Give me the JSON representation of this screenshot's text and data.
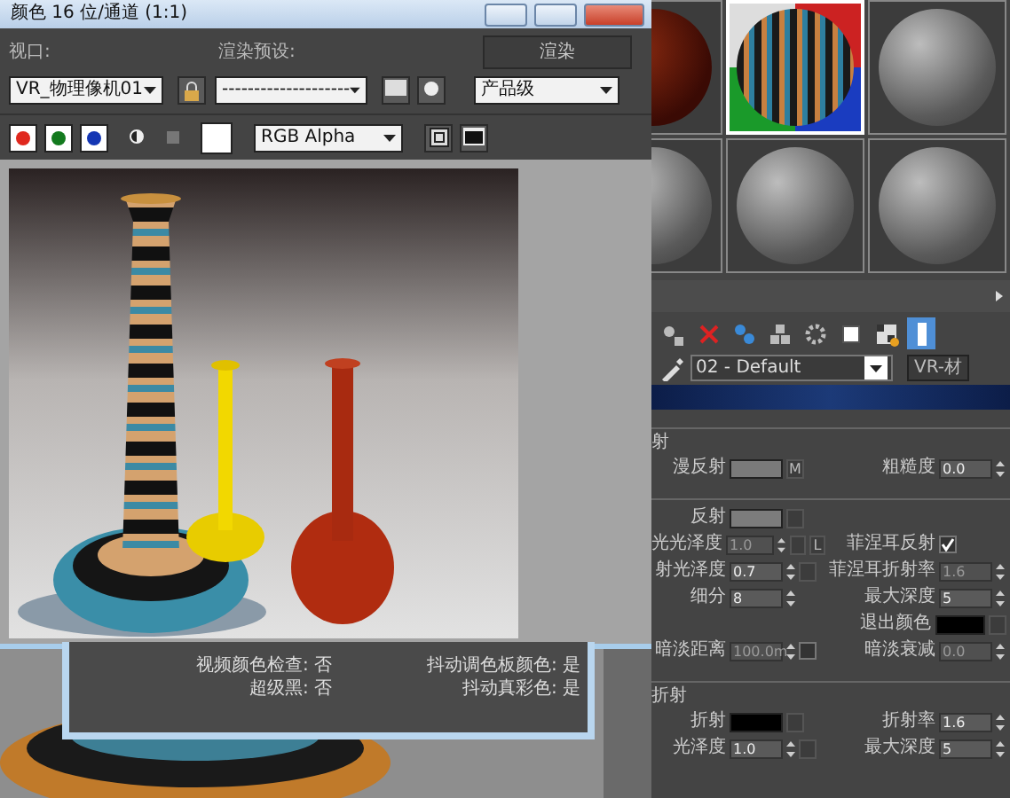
{
  "render_window": {
    "title": "颜色 16 位/通道 (1:1)",
    "viewport_label": "视口:",
    "viewport_value": "VR_物理像机01",
    "preset_label": "渲染预设:",
    "preset_value": "--------------------",
    "render_button": "渲染",
    "quality_value": "产品级",
    "channels": [
      {
        "color": "#e0281e",
        "on": true
      },
      {
        "color": "#137a1e",
        "on": true
      },
      {
        "color": "#1436b4",
        "on": true
      }
    ],
    "display_value": "RGB Alpha"
  },
  "info_panel": {
    "items": [
      {
        "label": "视频颜色检查:",
        "value": "否"
      },
      {
        "label": "抖动调色板颜色:",
        "value": "是"
      },
      {
        "label": "超级黑:",
        "value": "否"
      },
      {
        "label": "抖动真彩色:",
        "value": "是"
      }
    ]
  },
  "material_editor": {
    "slots": [
      {
        "kind": "wood",
        "selected": false
      },
      {
        "kind": "striped",
        "selected": true
      },
      {
        "kind": "plain",
        "selected": false
      },
      {
        "kind": "plain",
        "selected": false
      },
      {
        "kind": "plain",
        "selected": false
      },
      {
        "kind": "plain",
        "selected": false
      }
    ],
    "toolbar": [
      {
        "on": false
      },
      {
        "on": false
      },
      {
        "on": false
      },
      {
        "on": false
      },
      {
        "on": false
      },
      {
        "on": false
      },
      {
        "on": false
      },
      {
        "on": true
      }
    ],
    "material_name": "02 - Default",
    "type_button": "VR-材",
    "sections": [
      {
        "title": "射",
        "rows": [
          {
            "left": {
              "kind": "swatch",
              "label": "漫反射",
              "color": "#7a7a7a",
              "map": "M"
            },
            "right": {
              "kind": "spinner",
              "label": "粗糙度",
              "value": "0.0",
              "disabled": false
            }
          }
        ]
      },
      {
        "rows": [
          {
            "left": {
              "kind": "swatch",
              "label": "反射",
              "color": "#7c7c7c"
            }
          },
          {
            "left": {
              "kind": "spinner",
              "label": "光光泽度",
              "value": "1.0",
              "disabled": true,
              "map_slot": true,
              "lock": "L"
            },
            "right": {
              "kind": "checkbox",
              "label": "菲涅耳反射",
              "checked": true
            }
          },
          {
            "left": {
              "kind": "spinner",
              "label": "射光泽度",
              "value": "0.7",
              "disabled": false,
              "map_slot": true
            },
            "right": {
              "kind": "spinner",
              "label": "菲涅耳折射率",
              "value": "1.6",
              "disabled": true
            }
          },
          {
            "left": {
              "kind": "spinner",
              "label": "细分",
              "value": "8",
              "disabled": false
            },
            "right": {
              "kind": "spinner",
              "label": "最大深度",
              "value": "5",
              "disabled": false
            }
          },
          {
            "right": {
              "kind": "swatch",
              "label": "退出颜色",
              "color": "#000000"
            }
          },
          {
            "left": {
              "kind": "spinner",
              "label": "暗淡距离",
              "value": "100.0m",
              "disabled": true,
              "checked": false
            },
            "right": {
              "kind": "spinner",
              "label": "暗淡衰减",
              "value": "0.0",
              "disabled": true
            }
          }
        ]
      },
      {
        "title": "折射",
        "rows": [
          {
            "left": {
              "kind": "swatch",
              "label": "折射",
              "color": "#000000"
            },
            "right": {
              "kind": "spinner",
              "label": "折射率",
              "value": "1.6",
              "disabled": false
            }
          },
          {
            "left": {
              "kind": "spinner",
              "label": "光泽度",
              "value": "1.0",
              "disabled": false,
              "map_slot": true
            },
            "right": {
              "kind": "spinner",
              "label": "最大深度",
              "value": "5",
              "disabled": false
            }
          }
        ]
      }
    ]
  }
}
